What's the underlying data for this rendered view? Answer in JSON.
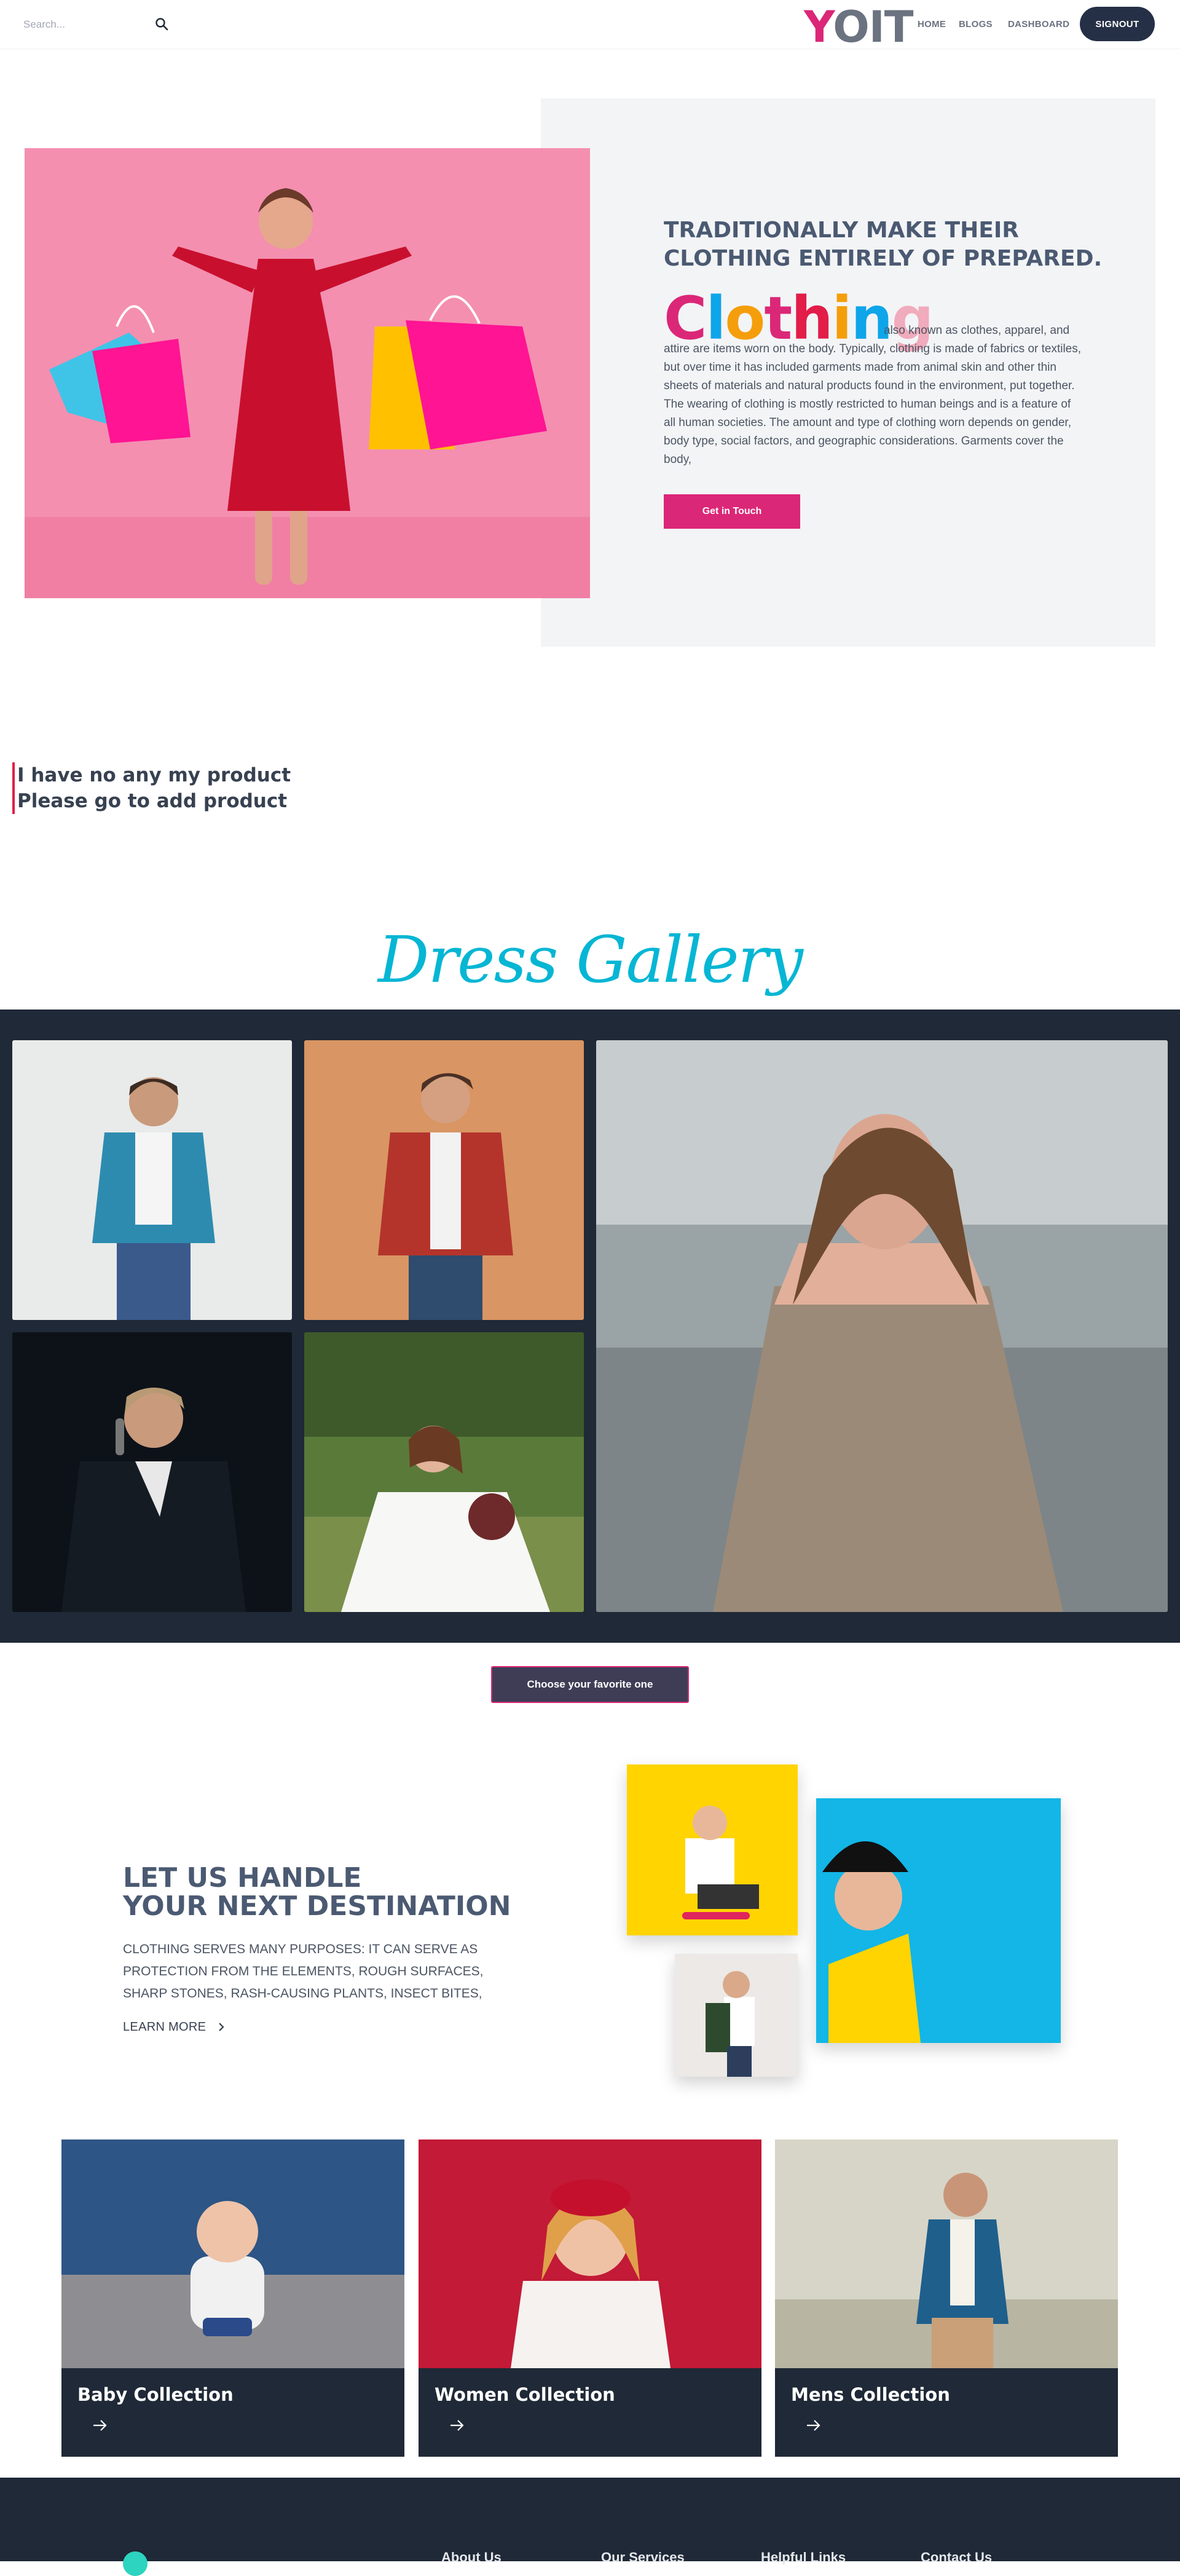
{
  "header": {
    "search_placeholder": "Search...",
    "logo_y": "Y",
    "logo_rest": "OIT",
    "nav": [
      "HOME",
      "BLOGS",
      "DASHBOARD"
    ],
    "signout": "SIGNOUT"
  },
  "hero": {
    "heading_line1": "TRADITIONALLY MAKE THEIR",
    "heading_line2": "CLOTHING ENTIRELY OF PREPARED.",
    "word_letters": [
      "C",
      "l",
      "o",
      "t",
      "h",
      "i",
      "n",
      "g"
    ],
    "word_colors": [
      "#db2777",
      "#0ea5e9",
      "#f59e0b",
      "#db2777",
      "#e11d48",
      "#f59e0b",
      "#0ea5e9",
      "#f0abbc"
    ],
    "paragraph": "also known as clothes, apparel, and attire are items worn on the body. Typically, clothing is made of fabrics or textiles, but over time it has included garments made from animal skin and other thin sheets of materials and natural products found in the environment, put together. The wearing of clothing is mostly restricted to human beings and is a feature of all human societies. The amount and type of clothing worn depends on gender, body type, social factors, and geographic considerations. Garments cover the body,",
    "button": "Get in Touch"
  },
  "notice": {
    "line1": "I have no any my product",
    "line2": "Please go to add product"
  },
  "gallery": {
    "title": "Dress Gallery",
    "button": "Choose your favorite one"
  },
  "destination": {
    "heading_line1": "LET US HANDLE",
    "heading_line2": "YOUR NEXT DESTINATION",
    "text": "CLOTHING SERVES MANY PURPOSES: IT CAN SERVE AS PROTECTION FROM THE ELEMENTS, ROUGH SURFACES, SHARP STONES, RASH-CAUSING PLANTS, INSECT BITES,",
    "learn_more": "LEARN MORE"
  },
  "collections": [
    {
      "title": "Baby Collection"
    },
    {
      "title": "Women Collection"
    },
    {
      "title": "Mens Collection"
    }
  ],
  "footer": {
    "columns": [
      "About Us",
      "Our Services",
      "Helpful Links",
      "Contact Us"
    ]
  },
  "colors": {
    "brand": "#db2777",
    "dark": "#1f2937",
    "accent": "#06b6d4"
  }
}
